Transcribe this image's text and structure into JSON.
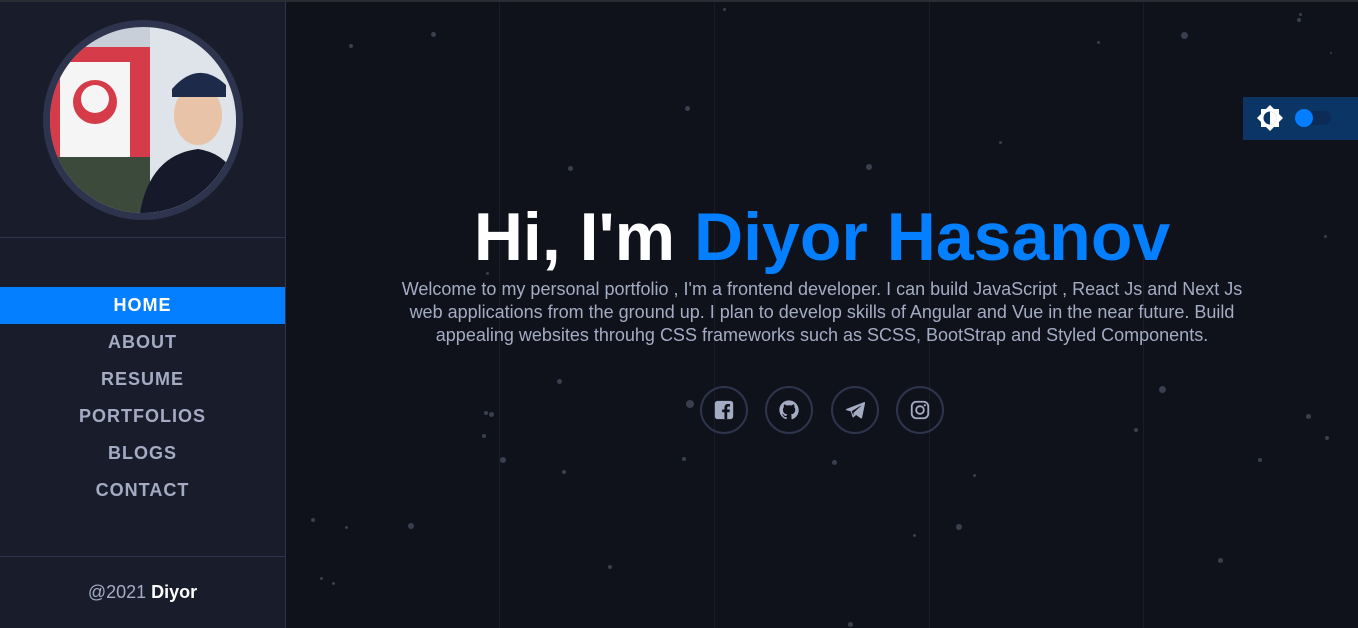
{
  "sidebar": {
    "avatar_alt": "Diyor Hasanov photo",
    "nav": [
      {
        "label": "Home",
        "active": true
      },
      {
        "label": "About",
        "active": false
      },
      {
        "label": "Resume",
        "active": false
      },
      {
        "label": "Portfolios",
        "active": false
      },
      {
        "label": "Blogs",
        "active": false
      },
      {
        "label": "Contact",
        "active": false
      }
    ],
    "footer": {
      "prefix": "@2021 ",
      "name": "Diyor"
    }
  },
  "hero": {
    "greeting": "Hi, I'm ",
    "name": "Diyor Hasanov",
    "intro": "Welcome to my personal portfolio , I'm a frontend developer. I can build JavaScript , React Js and Next Js web applications from the ground up. I plan to develop skills of Angular and Vue in the near future. Build appealing websites throuhg CSS frameworks such as SCSS, BootStrap and Styled Components."
  },
  "socials": [
    {
      "icon": "facebook-icon"
    },
    {
      "icon": "github-icon"
    },
    {
      "icon": "telegram-icon"
    },
    {
      "icon": "instagram-icon"
    }
  ],
  "theme_toggle": {
    "icon": "brightness-icon",
    "state": "dark"
  },
  "colors": {
    "accent": "#037fff",
    "sidebar_bg": "#191d2b",
    "main_bg": "#10121b",
    "text_muted": "#a4acc4"
  }
}
